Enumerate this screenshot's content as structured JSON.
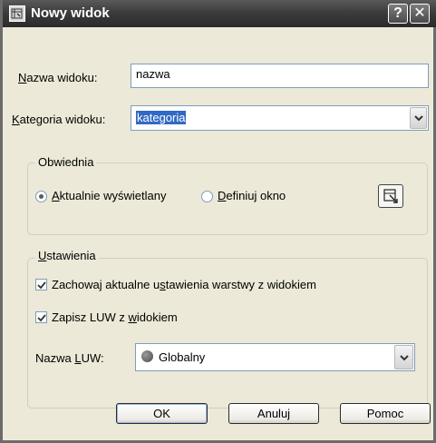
{
  "window": {
    "title": "Nowy widok",
    "help_label": "?",
    "close_label": "✕"
  },
  "name_field": {
    "label_underlined": "N",
    "label_rest": "azwa widoku:",
    "value": "nazwa"
  },
  "category_field": {
    "label_underlined": "K",
    "label_rest": "ategoria widoku:",
    "value": "kategoria"
  },
  "boundary_group": {
    "legend": "Obwiednia",
    "radio_current": {
      "label_underlined": "A",
      "label_rest": "ktualnie wyświetlany",
      "checked": true
    },
    "radio_define": {
      "label_underlined": "D",
      "label_rest": "efiniuj okno",
      "checked": false
    }
  },
  "settings_group": {
    "legend_underlined": "U",
    "legend_rest": "stawienia",
    "check_layers": {
      "label_a": "Zachowaj aktualne u",
      "label_u": "s",
      "label_b": "tawienia warstwy z widokiem",
      "checked": true
    },
    "check_ucs": {
      "label_a": "Zapisz LUW z ",
      "label_u": "w",
      "label_b": "idokiem",
      "checked": true
    },
    "ucs_name": {
      "label_a": "Nazwa ",
      "label_u": "L",
      "label_b": "UW:",
      "value": "Globalny"
    }
  },
  "buttons": {
    "ok": "OK",
    "cancel": "Anuluj",
    "help": "Pomoc"
  },
  "icons": {
    "app": "view-icon",
    "pick": "pick-window-icon",
    "globe": "globe-icon",
    "dropdown": "chevron-down-icon"
  }
}
